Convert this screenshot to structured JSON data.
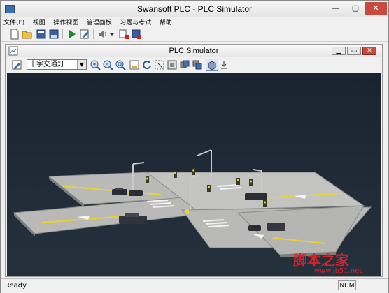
{
  "app": {
    "title": "Swansoft PLC - PLC Simulator"
  },
  "menu": {
    "items": [
      "文件(F)",
      "视图",
      "操作视图",
      "管理面板",
      "习题与考试",
      "帮助"
    ]
  },
  "toolbar": {
    "icons": [
      "new-icon",
      "open-icon",
      "save-icon",
      "save-as-icon",
      "run-icon",
      "edit-icon",
      "speaker-icon",
      "dropdown-icon",
      "stop-icon",
      "save-red-icon"
    ]
  },
  "sim": {
    "title": "PLC Simulator",
    "scene_select": "十字交通灯"
  },
  "status": {
    "text": "Ready",
    "num": "NUM"
  },
  "watermark": {
    "text": "脚本之家",
    "url": "www.jb51.net"
  },
  "colors": {
    "scene_bg": "#1c2530",
    "road": "#b9bab7",
    "lane_yellow": "#e8d23a",
    "watermark_red": "#d4222a"
  }
}
